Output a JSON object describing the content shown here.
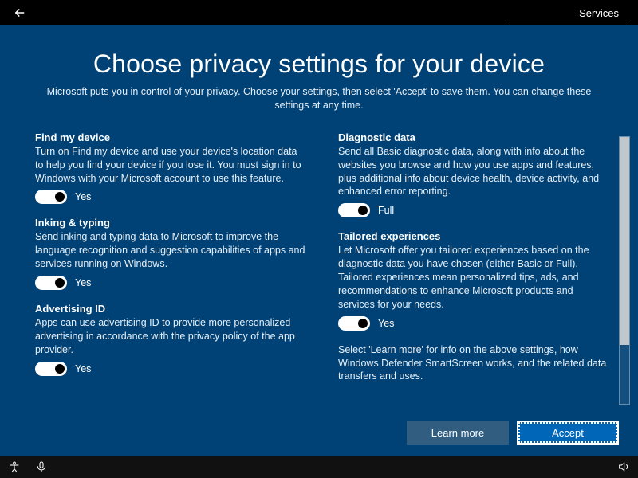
{
  "titlebar": {
    "services_tab": "Services"
  },
  "header": {
    "title": "Choose privacy settings for your device",
    "subtitle": "Microsoft puts you in control of your privacy. Choose your settings, then select 'Accept' to save them. You can change these settings at any time."
  },
  "left_column": {
    "find_my_device": {
      "title": "Find my device",
      "desc": "Turn on Find my device and use your device's location data to help you find your device if you lose it. You must sign in to Windows with your Microsoft account to use this feature.",
      "value_label": "Yes"
    },
    "inking_typing": {
      "title": "Inking & typing",
      "desc": "Send inking and typing data to Microsoft to improve the language recognition and suggestion capabilities of apps and services running on Windows.",
      "value_label": "Yes"
    },
    "advertising_id": {
      "title": "Advertising ID",
      "desc": "Apps can use advertising ID to provide more personalized advertising in accordance with the privacy policy of the app provider.",
      "value_label": "Yes"
    }
  },
  "right_column": {
    "diagnostic_data": {
      "title": "Diagnostic data",
      "desc": "Send all Basic diagnostic data, along with info about the websites you browse and how you use apps and features, plus additional info about device health, device activity, and enhanced error reporting.",
      "value_label": "Full"
    },
    "tailored_experiences": {
      "title": "Tailored experiences",
      "desc": "Let Microsoft offer you tailored experiences based on the diagnostic data you have chosen (either Basic or Full). Tailored experiences mean personalized tips, ads, and recommendations to enhance Microsoft products and services for your needs.",
      "value_label": "Yes"
    },
    "note": "Select 'Learn more' for info on the above settings, how Windows Defender SmartScreen works, and the related data transfers and uses."
  },
  "footer": {
    "learn_more": "Learn more",
    "accept": "Accept"
  }
}
